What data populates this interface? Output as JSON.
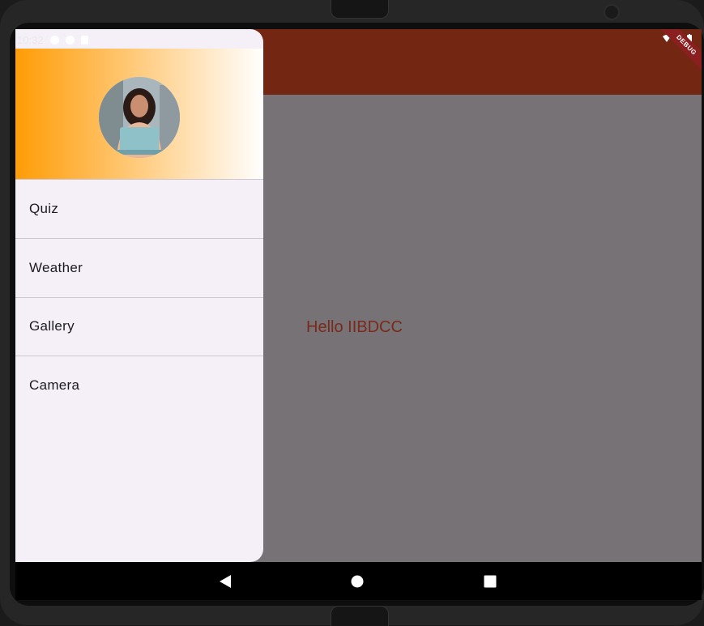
{
  "status_bar": {
    "time": "10:32",
    "left_icons": [
      "settings-icon",
      "shield-icon",
      "sim-card-icon"
    ],
    "right_icons": [
      "wifi-icon",
      "signal-icon",
      "battery-icon"
    ]
  },
  "debug_banner": "DEBUG",
  "main": {
    "text": "Hello IIBDCC",
    "text_color": "#7a2a1c",
    "app_bar_color": "#732612"
  },
  "drawer": {
    "header_gradient": [
      "#ff9c06",
      "#ffffff"
    ],
    "avatar": "profile-photo",
    "items": [
      {
        "label": "Quiz"
      },
      {
        "label": "Weather"
      },
      {
        "label": "Gallery"
      },
      {
        "label": "Camera"
      }
    ]
  },
  "nav_bar": {
    "buttons": [
      "back-icon",
      "home-icon",
      "recents-icon"
    ]
  }
}
